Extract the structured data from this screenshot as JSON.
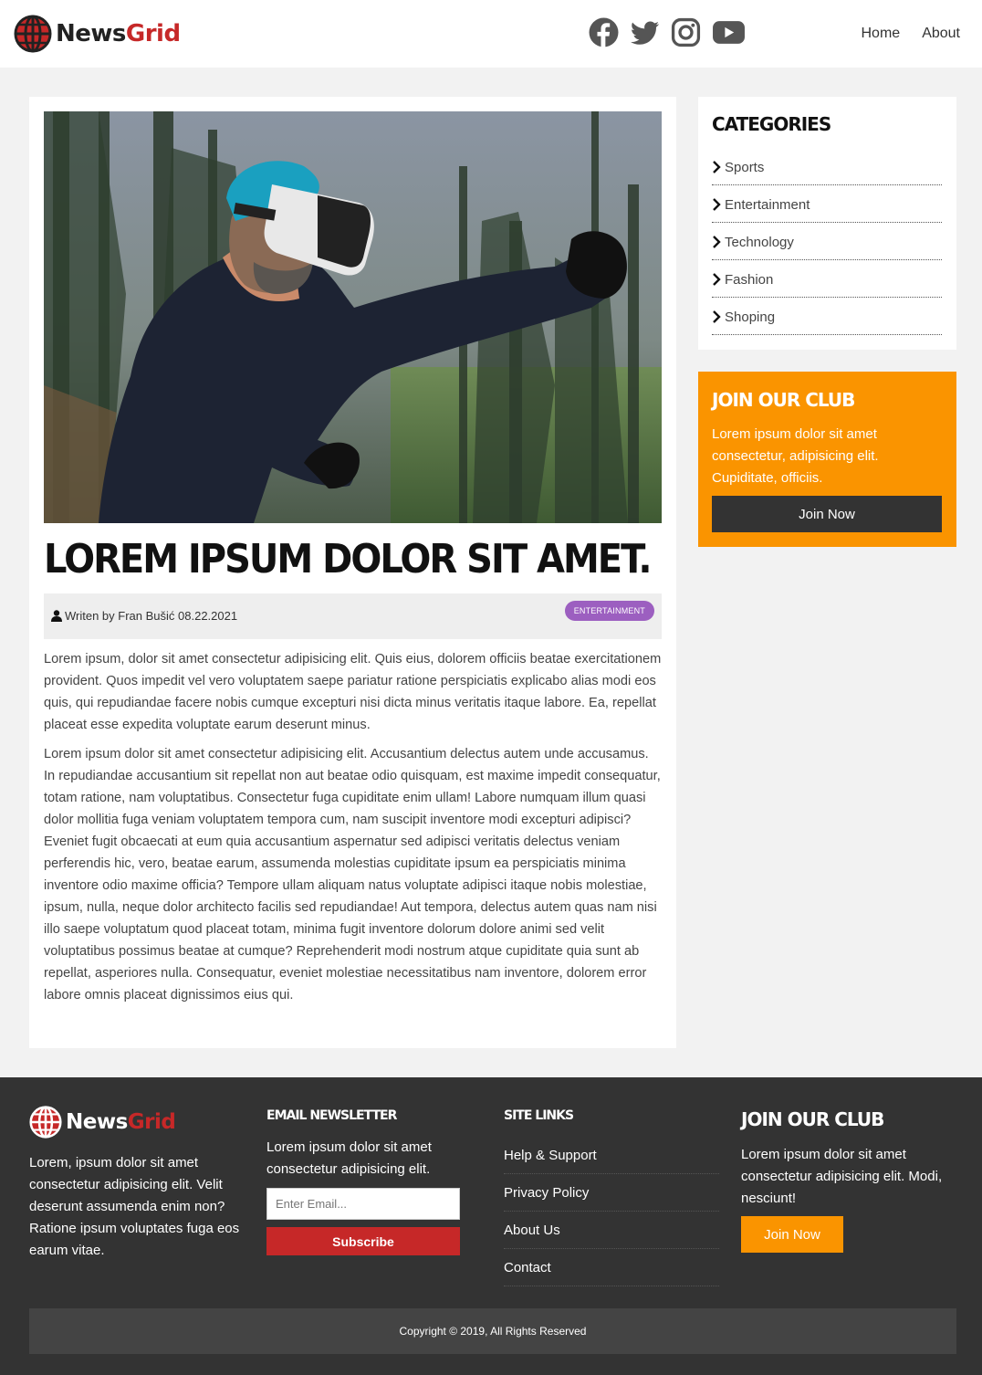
{
  "brand": {
    "name_part1": "News",
    "name_part2": "Grid"
  },
  "header": {
    "socials": [
      "facebook-icon",
      "twitter-icon",
      "instagram-icon",
      "youtube-icon"
    ],
    "nav": [
      "Home",
      "About"
    ]
  },
  "article": {
    "image_description_icon": "vr-runner-photo",
    "title": "LOREM IPSUM DOLOR SIT AMET.",
    "meta": {
      "author_text": "Writen by Fran Bušić 08.22.2021",
      "category_badge": "ENTERTAINMENT"
    },
    "paragraphs": [
      "Lorem ipsum, dolor sit amet consectetur adipisicing elit. Quis eius, dolorem officiis beatae exercitationem provident. Quos impedit vel vero voluptatem saepe pariatur ratione perspiciatis explicabo alias modi eos quis, qui repudiandae facere nobis cumque excepturi nisi dicta minus veritatis itaque labore. Ea, repellat placeat esse expedita voluptate earum deserunt minus.",
      "Lorem ipsum dolor sit amet consectetur adipisicing elit. Accusantium delectus autem unde accusamus. In repudiandae accusantium sit repellat non aut beatae odio quisquam, est maxime impedit consequatur, totam ratione, nam voluptatibus. Consectetur fuga cupiditate enim ullam! Labore numquam illum quasi dolor mollitia fuga veniam voluptatem tempora cum, nam suscipit inventore modi excepturi adipisci? Eveniet fugit obcaecati at eum quia accusantium aspernatur sed adipisci veritatis delectus veniam perferendis hic, vero, beatae earum, assumenda molestias cupiditate ipsum ea perspiciatis minima inventore odio maxime officia? Tempore ullam aliquam natus voluptate adipisci itaque nobis molestiae, ipsum, nulla, neque dolor architecto facilis sed repudiandae! Aut tempora, delectus autem quas nam nisi illo saepe voluptatum quod placeat totam, minima fugit inventore dolorum dolore animi sed velit voluptatibus possimus beatae at cumque? Reprehenderit modi nostrum atque cupiditate quia sunt ab repellat, asperiores nulla. Consequatur, eveniet molestiae necessitatibus nam inventore, dolorem error labore omnis placeat dignissimos eius qui."
    ]
  },
  "sidebar": {
    "categories_title": "CATEGORIES",
    "categories": [
      "Sports",
      "Entertainment",
      "Technology",
      "Fashion",
      "Shoping"
    ],
    "club": {
      "title": "JOIN OUR CLUB",
      "text": "Lorem ipsum dolor sit amet consectetur, adipisicing elit. Cupiditate, officiis.",
      "button": "Join Now"
    }
  },
  "footer": {
    "about": "Lorem, ipsum dolor sit amet consectetur adipisicing elit. Velit deserunt assumenda enim non? Ratione ipsum voluptates fuga eos earum vitae.",
    "newsletter": {
      "title": "EMAIL NEWSLETTER",
      "text": "Lorem ipsum dolor sit amet consectetur adipisicing elit.",
      "placeholder": "Enter Email...",
      "button": "Subscribe"
    },
    "links": {
      "title": "SITE LINKS",
      "items": [
        "Help & Support",
        "Privacy Policy",
        "About Us",
        "Contact"
      ]
    },
    "club": {
      "title": "JOIN OUR CLUB",
      "text": "Lorem ipsum dolor sit amet consectetur adipisicing elit. Modi, nesciunt!",
      "button": "Join Now"
    },
    "copyright": "Copyright © 2019, All Rights Reserved"
  },
  "colors": {
    "accent_red": "#c62828",
    "accent_orange": "#fa9400",
    "badge_purple": "#9c5fc0",
    "footer_bg": "#333333"
  }
}
